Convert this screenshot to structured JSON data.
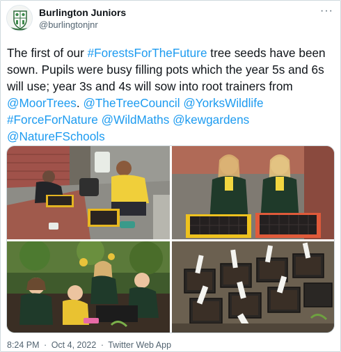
{
  "account": {
    "name": "Burlington Juniors",
    "handle": "@burlingtonjnr",
    "more_glyph": "···"
  },
  "tweet": {
    "t1": "The first of our ",
    "hashtag_forests": "#ForestsForTheFuture",
    "t2": " tree seeds have been sown. Pupils were busy filling pots which the year 5s and 6s will use; year 3s and 4s will sow into root trainers from ",
    "mention_moortrees": "@MoorTrees",
    "t3": ". ",
    "mention_treecouncil": "@TheTreeCouncil",
    "mention_yorkswildlife": "@YorksWildlife",
    "hashtag_forcefornature": "#ForceForNature",
    "mention_wildmaths": "@WildMaths",
    "mention_kewgardens": "@kewgardens",
    "mention_naturefschools": "@NatureFSchools"
  },
  "footer": {
    "time": "8:24 PM",
    "sep1": "·",
    "date": "Oct 4, 2022",
    "sep2": "·",
    "source": "Twitter Web App"
  },
  "colors": {
    "link": "#1d9bf0",
    "text": "#0f1419",
    "muted": "#536471"
  }
}
